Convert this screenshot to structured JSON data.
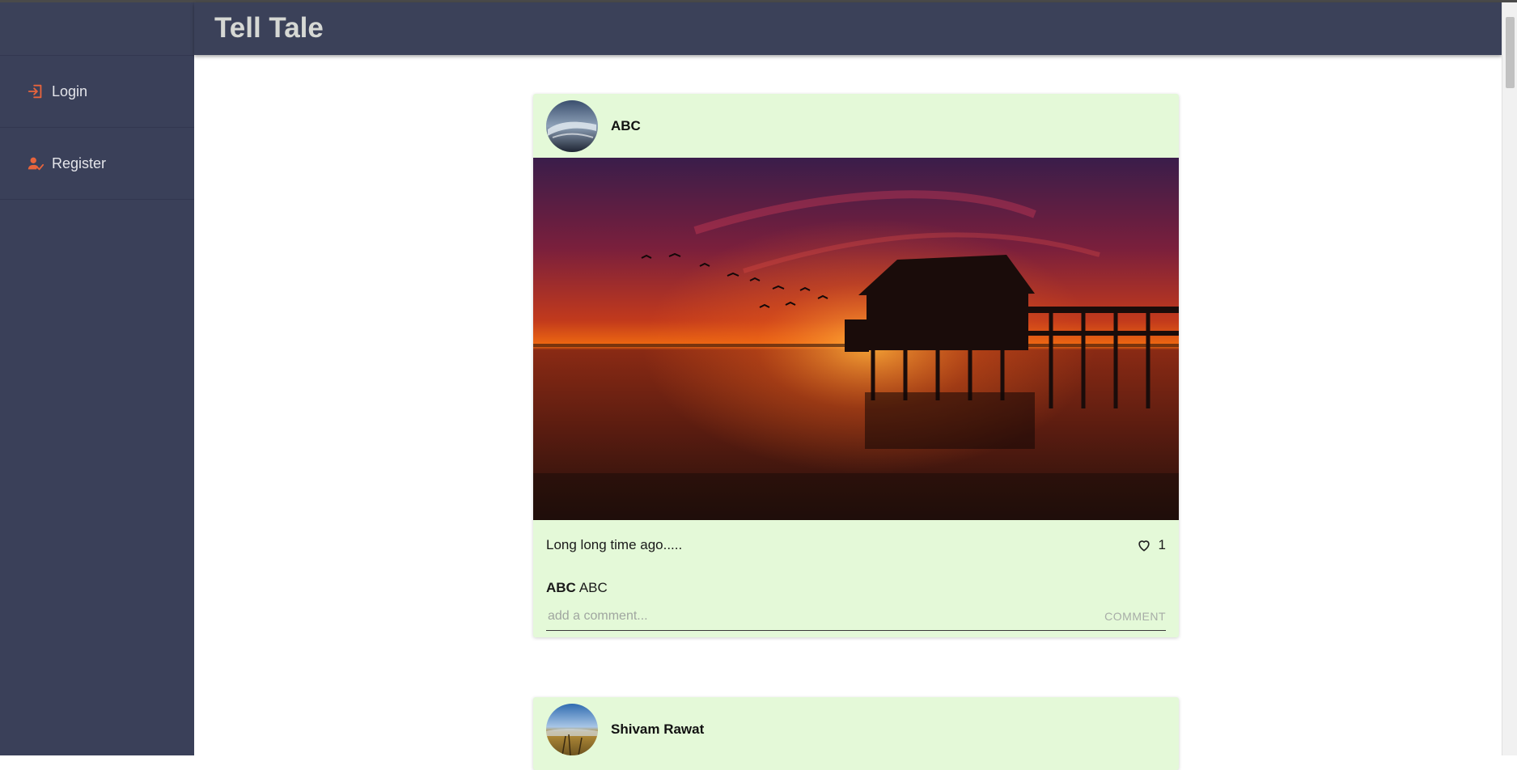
{
  "app": {
    "title": "Tell Tale"
  },
  "sidebar": {
    "items": [
      {
        "label": "Login",
        "icon": "login-icon"
      },
      {
        "label": "Register",
        "icon": "person-check-icon"
      }
    ]
  },
  "posts": [
    {
      "username": "ABC",
      "caption": "Long long time ago.....",
      "likes": "1",
      "comment": {
        "user": "ABC",
        "text": "ABC"
      },
      "comment_placeholder": "add a comment...",
      "comment_button": "COMMENT"
    },
    {
      "username": "Shivam Rawat"
    }
  ],
  "colors": {
    "sidebar_bg": "#3a4059",
    "header_bg": "#3b4159",
    "card_bg": "#e4f9d8",
    "accent": "#e8643c"
  }
}
